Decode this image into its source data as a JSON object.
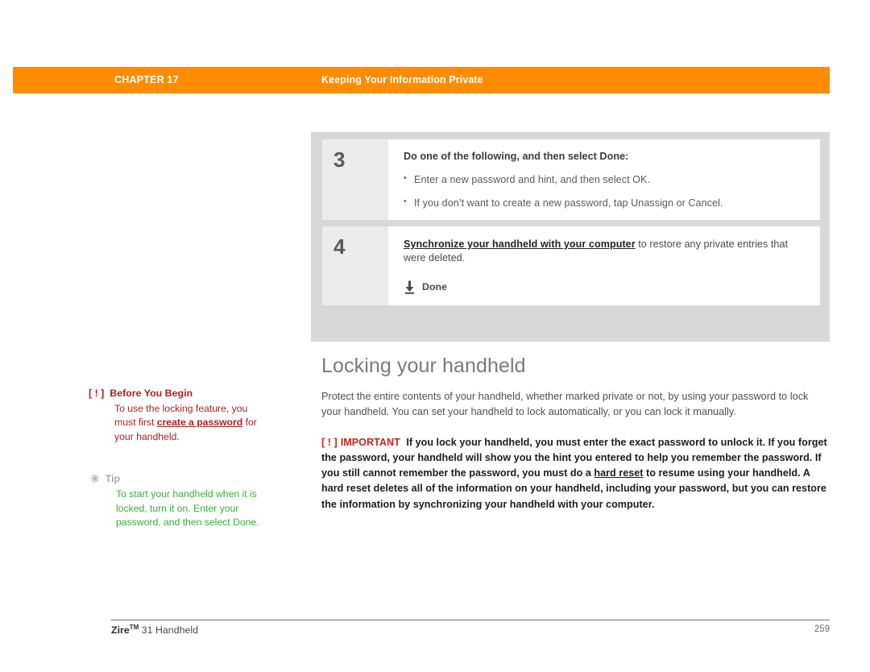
{
  "header": {
    "chapter_label": "CHAPTER 17",
    "title": "Keeping Your Information Private",
    "bar_color": "#ff8c00"
  },
  "steps": [
    {
      "number": "3",
      "lead": "Do one of the following, and then select Done:",
      "bullets": [
        "Enter a new password and hint, and then select OK.",
        "If you don’t want to create a new password, tap Unassign or Cancel."
      ]
    },
    {
      "number": "4",
      "link_text": "Synchronize your handheld with your computer",
      "rest_text": " to restore any private entries that were deleted.",
      "done_label": "Done",
      "done_icon": "download-arrow-icon"
    }
  ],
  "main": {
    "heading": "Locking your handheld",
    "paragraph": "Protect the entire contents of your handheld, whether marked private or not, by using your password to lock your handheld. You can set your handheld to lock automatically, or you can lock it manually.",
    "important": {
      "marker": "[ ! ]",
      "tag": "IMPORTANT",
      "text_before_link": "If you lock your handheld, you must enter the exact password to unlock it. If you forget the password, your handheld will show you the hint you entered to help you remember the password. If you still cannot remember the password, you must do a ",
      "link_text": "hard reset",
      "text_after_link": " to resume using your handheld. A hard reset deletes all of the information on your handheld, including your password, but you can restore the information by synchronizing your handheld with your computer.",
      "tag_color": "#d0211c"
    }
  },
  "notes": [
    {
      "marker": "[ ! ]",
      "title": "Before You Begin",
      "text_before_link": "To use the locking feature, you must first ",
      "link_text": "create a password",
      "text_after_link": " for your handheld.",
      "color": "#b01f24"
    },
    {
      "marker": "✳",
      "title": "Tip",
      "text": "To start your handheld when it is locked, turn it on. Enter your password, and then select Done.",
      "color": "#3cae3c"
    }
  ],
  "footer": {
    "product": "Zire",
    "trademark": "TM",
    "product_suffix": " 31 Handheld",
    "page_number": "259"
  }
}
